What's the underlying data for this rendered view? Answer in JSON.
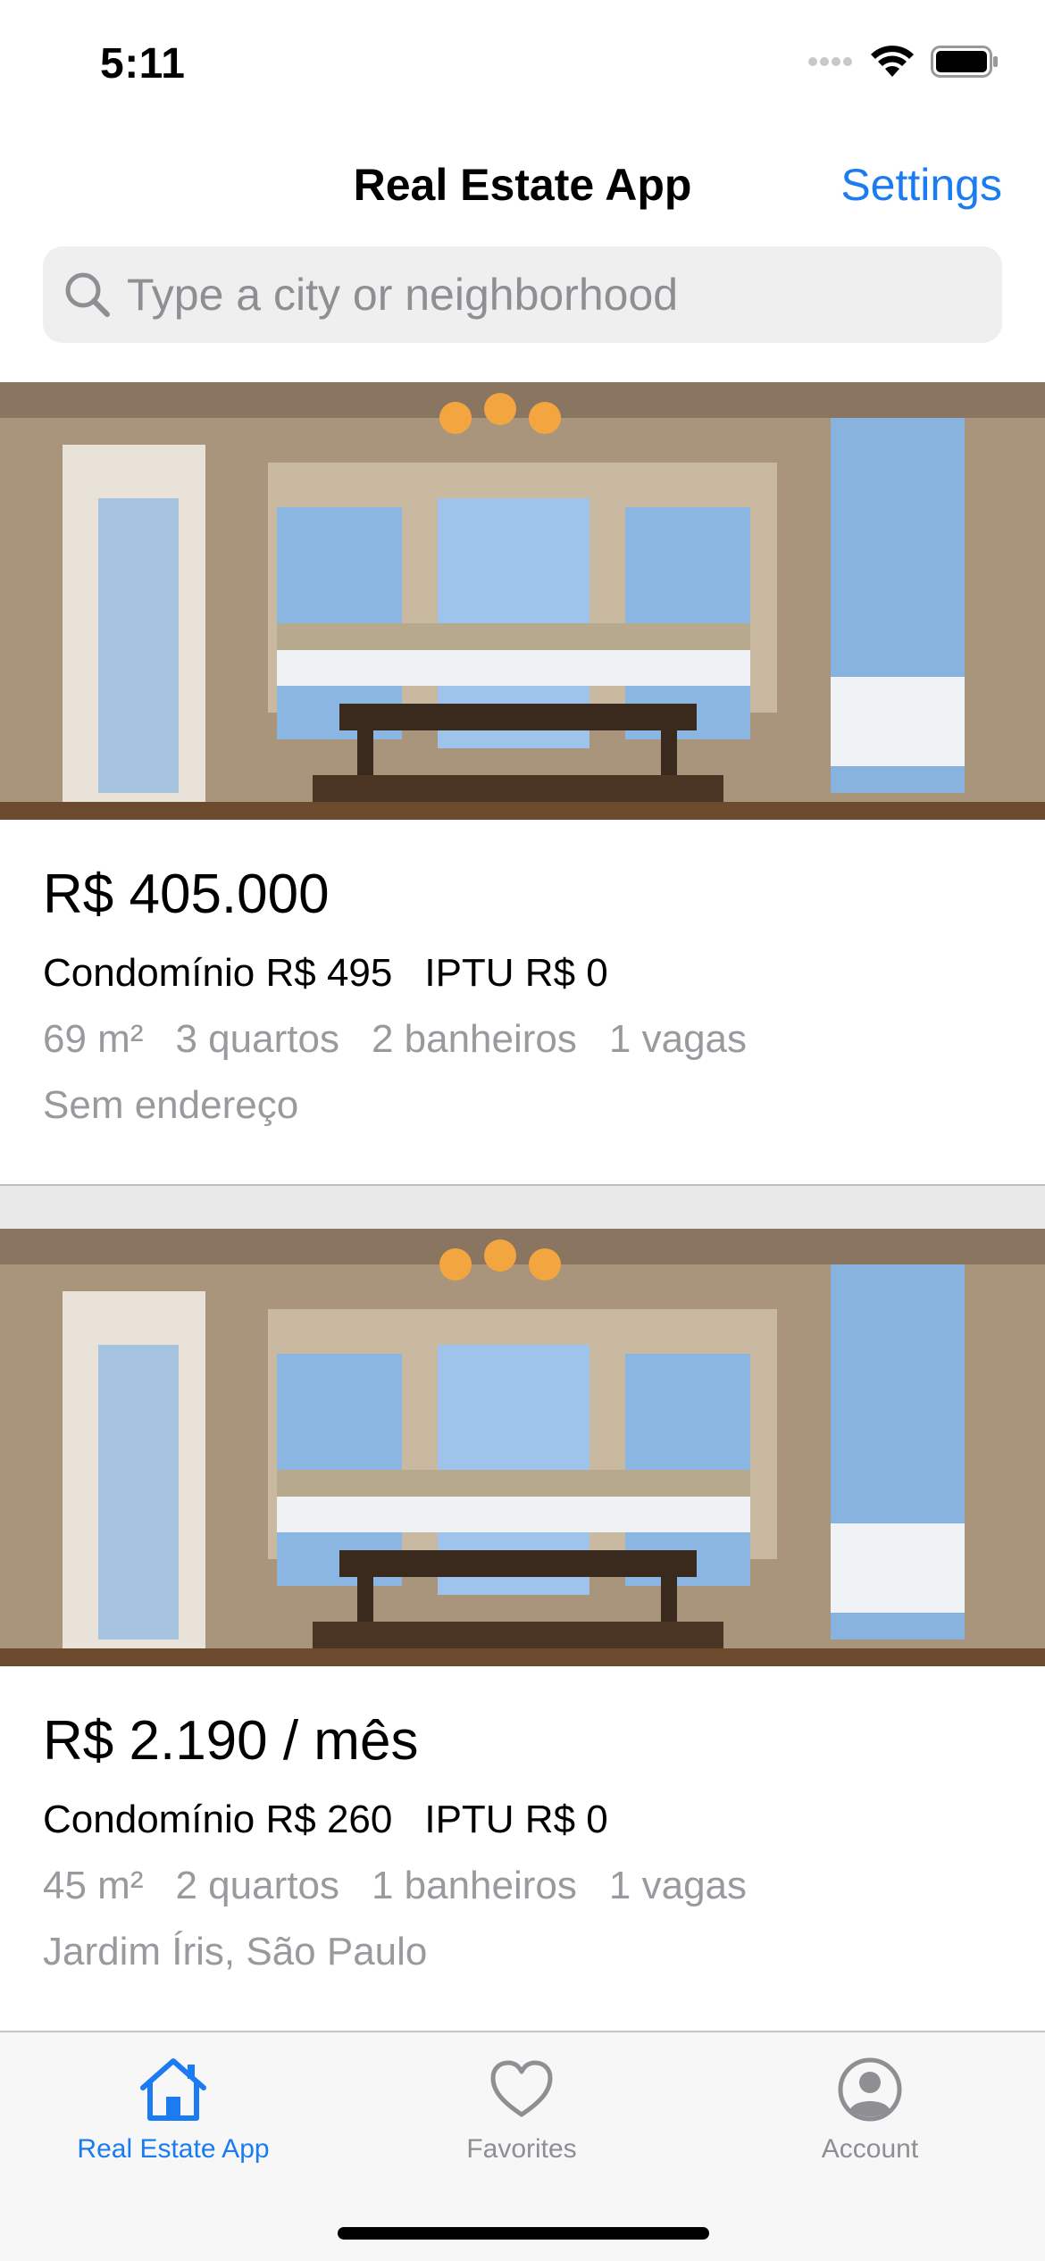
{
  "status_bar": {
    "time": "5:11"
  },
  "nav": {
    "title": "Real Estate App",
    "settings_label": "Settings"
  },
  "search": {
    "placeholder": "Type a city or neighborhood",
    "value": ""
  },
  "listings": [
    {
      "price": "R$ 405.000",
      "condominio": "Condomínio R$ 495",
      "iptu": "IPTU R$ 0",
      "area": "69 m²",
      "rooms": "3 quartos",
      "bathrooms": "2 banheiros",
      "parking": "1 vagas",
      "address": "Sem endereço"
    },
    {
      "price": "R$ 2.190 / mês",
      "condominio": "Condomínio R$ 260",
      "iptu": "IPTU R$ 0",
      "area": "45 m²",
      "rooms": "2 quartos",
      "bathrooms": "1 banheiros",
      "parking": "1 vagas",
      "address": "Jardim Íris, São Paulo"
    }
  ],
  "tabs": [
    {
      "label": "Real Estate App",
      "icon": "house-icon",
      "active": true
    },
    {
      "label": "Favorites",
      "icon": "heart-icon",
      "active": false
    },
    {
      "label": "Account",
      "icon": "person-circle-icon",
      "active": false
    }
  ],
  "colors": {
    "accent": "#1a7cf0",
    "secondary_text": "#9a9a9e",
    "separator": "#e9e9ea"
  }
}
